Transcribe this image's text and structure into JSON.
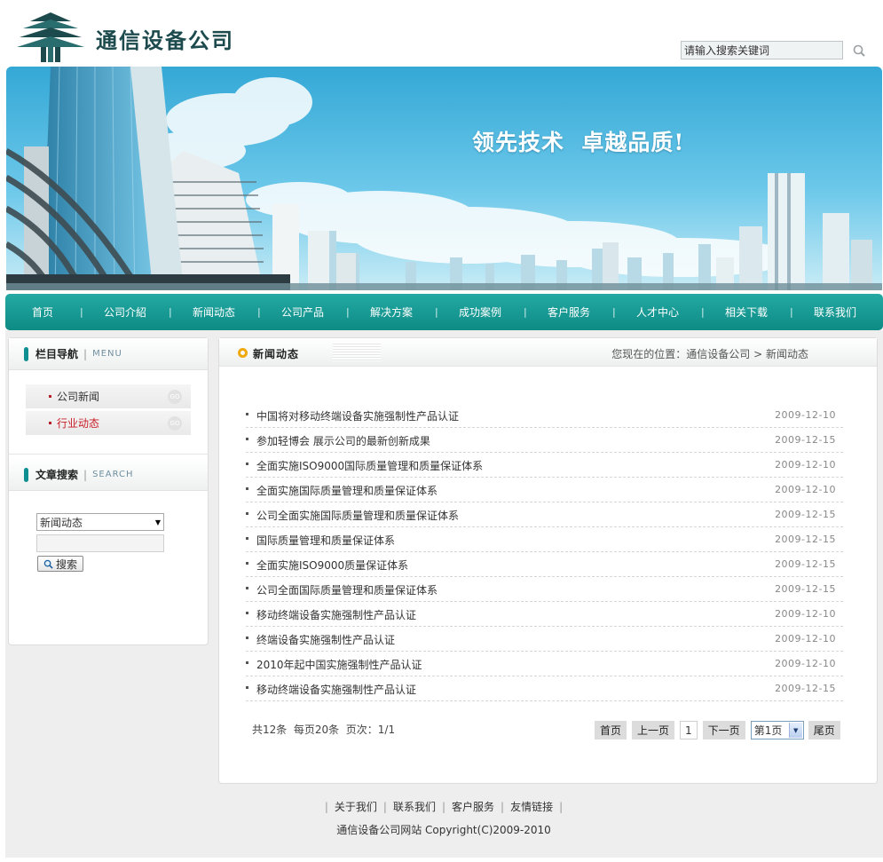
{
  "header": {
    "company_name": "通信设备公司",
    "search_placeholder": "请输入搜索关键词"
  },
  "banner": {
    "slogan": "领先技术  卓越品质!"
  },
  "nav": {
    "items": [
      "首页",
      "公司介紹",
      "新闻动态",
      "公司产品",
      "解决方案",
      "成功案例",
      "客户服务",
      "人才中心",
      "相关下载",
      "联系我们"
    ]
  },
  "sidebar": {
    "menu_title": "栏目导航",
    "menu_en": "MENU",
    "items": [
      {
        "label": "公司新闻",
        "go": "GO"
      },
      {
        "label": "行业动态",
        "go": "GO"
      }
    ],
    "search_title": "文章搜索",
    "search_en": "SEARCH",
    "search_select_value": "新闻动态",
    "search_button": "搜索"
  },
  "main": {
    "title": "新闻动态",
    "breadcrumb_prefix": "您现在的位置：",
    "breadcrumb_home": "通信设备公司",
    "breadcrumb_sep": " > ",
    "breadcrumb_current": "新闻动态",
    "news": [
      {
        "title": "中国将对移动终端设备实施强制性产品认证",
        "date": "2009-12-10"
      },
      {
        "title": "参加轻博会 展示公司的最新创新成果",
        "date": "2009-12-15"
      },
      {
        "title": "全面实施ISO9000国际质量管理和质量保证体系",
        "date": "2009-12-10"
      },
      {
        "title": "全面实施国际质量管理和质量保证体系",
        "date": "2009-12-10"
      },
      {
        "title": "公司全面实施国际质量管理和质量保证体系",
        "date": "2009-12-15"
      },
      {
        "title": "国际质量管理和质量保证体系",
        "date": "2009-12-15"
      },
      {
        "title": "全面实施ISO9000质量保证体系",
        "date": "2009-12-15"
      },
      {
        "title": "公司全面国际质量管理和质量保证体系",
        "date": "2009-12-15"
      },
      {
        "title": "移动终端设备实施强制性产品认证",
        "date": "2009-12-10"
      },
      {
        "title": "终端设备实施强制性产品认证",
        "date": "2009-12-10"
      },
      {
        "title": "2010年起中国实施强制性产品认证",
        "date": "2009-12-10"
      },
      {
        "title": "移动终端设备实施强制性产品认证",
        "date": "2009-12-15"
      }
    ],
    "pager": {
      "info": "共12条  每页20条  页次：1/1",
      "first": "首页",
      "prev": "上一页",
      "current": "1",
      "next": "下一页",
      "select_value": "第1页",
      "last": "尾页"
    }
  },
  "footer": {
    "links": [
      "关于我们",
      "联系我们",
      "客户服务",
      "友情链接"
    ],
    "copyright": "通信设备公司网站  Copyright(C)2009-2010"
  },
  "colors": {
    "nav_teal": "#129c96",
    "accent_red": "#c81d25",
    "ring_orange": "#f0a90c",
    "logo_green": "#1c4a4d"
  }
}
